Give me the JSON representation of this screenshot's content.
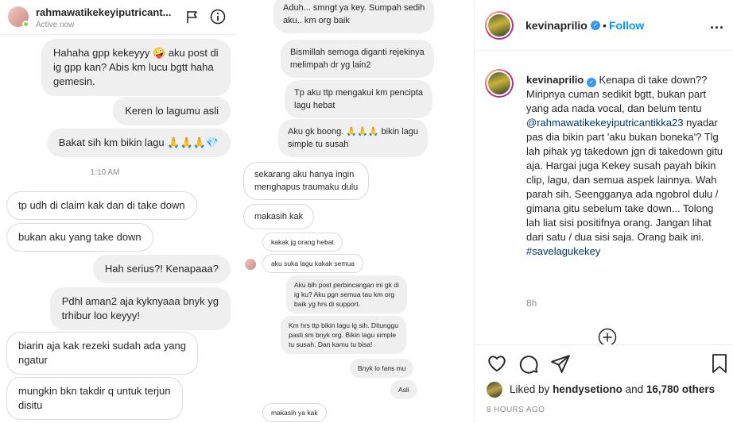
{
  "chat_header": {
    "username": "rahmawatikekeyiputricant...",
    "status": "Active now"
  },
  "left_messages": [
    "Hahaha gpp kekeyyy 🤪 aku post di\nig gpp kan? Abis km lucu bgtt haha\ngemesin.",
    "Keren lo lagumu asli",
    "Bakat sih km bikin lagu 🙏🙏🙏💎",
    "tp udh di claim kak dan di take down",
    "bukan aku yang take down",
    "Hah serius?! Kenapaaa?",
    "Pdhl aman2 aja kyknyaaa bnyk yg\ntrhibur loo keyyy!",
    "biarin aja kak rezeki sudah ada yang\nngatur",
    "mungkin bkn takdir q untuk terjun\ndisitu"
  ],
  "timestamp_left": "1:10 AM",
  "right_messages": [
    "Aduh... smngt ya key. Sumpah sedih\naku.. km org baik",
    "Bismillah semoga diganti rejekinya\nmelimpah dr yg lain2",
    "Tp aku ttp mengakui km pencipta\nlagu hebat",
    "Aku gk boong. 🙏🙏🙏 bikin lagu\nsimple tu susah",
    "sekarang aku hanya ingin\nmenghapus traumaku dulu",
    "makasih kak",
    "kakak jg orang hebat",
    "aku suka lagu kakak semua",
    "Aku blh post perbincangan ini gk di\nig ku? Aku pgn semua tau km org\nbaik yg hrs di support.",
    "Km hrs ttp bikin lagu lg sih. Ditunggu\npasti sm bnyk org. Bikin lagu simple\ntu susah. Dan kamu tu bisa!",
    "Bnyk lo fans mu",
    "Asli",
    "makasih ya kak"
  ],
  "post_header": {
    "username": "kevinaprilio",
    "separator": "•",
    "follow": "Follow",
    "more": "..."
  },
  "caption": {
    "username": "kevinaprilio",
    "line1": "Kenapa di take down??",
    "body1": "Miripnya cuman sedikit bgtt, bukan part yang ada nada vocal, dan belum tentu",
    "mention": "@rahmawatikekeyiputricantikka23",
    "body2": "nyadar pas dia bikin part 'aku bukan boneka'? Tlg lah pihak yg takedown jgn di takedown gitu aja. Hargai juga Kekey susah payah bikin clip, lagu, dan semua aspek lainnya. Wah parah sih. Seengganya ada ngobrol dulu / gimana gitu sebelum take down... Tolong lah liat sisi positifnya orang. Jangan lihat dari satu / dua sisi saja. Orang baik ini.",
    "hashtag": "#savelagukekey",
    "time": "8h"
  },
  "likes": {
    "prefix": "Liked by",
    "user": "hendysetiono",
    "and": "and",
    "count": "16,780 others"
  },
  "post_time": "8 HOURS AGO",
  "colors": {
    "link": "#00376b",
    "accent": "#0095f6",
    "verified": "#3897f0"
  }
}
